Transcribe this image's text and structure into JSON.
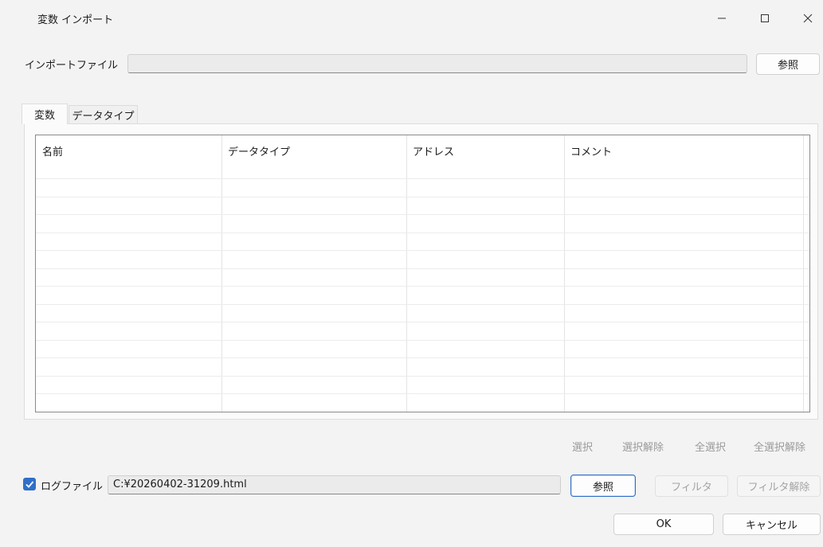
{
  "window": {
    "title": "変数 インポート",
    "controls": [
      "minimize-icon",
      "maximize-icon",
      "close-icon"
    ]
  },
  "import": {
    "label": "インポートファイル",
    "value": "",
    "browse_label": "参照"
  },
  "tabs": [
    {
      "label": "変数",
      "active": true
    },
    {
      "label": "データタイプ",
      "active": false
    }
  ],
  "table": {
    "columns": [
      "名前",
      "データタイプ",
      "アドレス",
      "コメント"
    ],
    "rows": []
  },
  "selection_actions": [
    "選択",
    "選択解除",
    "全選択",
    "全選択解除"
  ],
  "log": {
    "checked": true,
    "label": "ログファイル",
    "value": "C:¥20260402-31209.html",
    "browse_label": "参照",
    "filter_label": "フィルタ",
    "filter_clear_label": "フィルタ解除"
  },
  "footer": {
    "ok_label": "OK",
    "cancel_label": "キャンセル"
  },
  "colors": {
    "accent": "#2f6fc8",
    "background": "#f3f3f3",
    "disabled_text": "#a3a3a3"
  }
}
